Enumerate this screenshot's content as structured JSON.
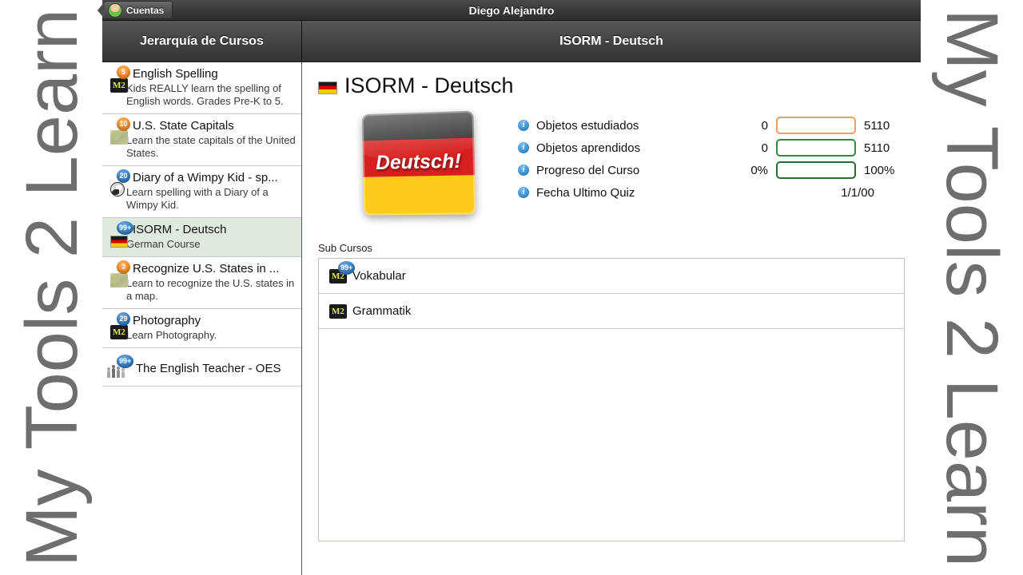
{
  "watermark": {
    "text": "My Tools 2 Learn"
  },
  "topbar": {
    "account_button_label": "Cuentas",
    "account_icon": "avatar-icon",
    "user_name": "Diego Alejandro"
  },
  "headers": {
    "sidebar_title": "Jerarquía de Cursos",
    "content_title": "ISORM - Deutsch"
  },
  "sidebar": {
    "items": [
      {
        "title": "English Spelling",
        "description": "Kids REALLY learn the spelling of English words. Grades Pre-K to 5.",
        "badge": "5",
        "badge_color": "#f08a21",
        "icon": "m2-icon",
        "selected": false
      },
      {
        "title": "U.S. State Capitals",
        "description": "Learn the state capitals of the United States.",
        "badge": "10",
        "badge_color": "#f08a21",
        "icon": "map-icon",
        "selected": false
      },
      {
        "title": "Diary of a Wimpy Kid - sp...",
        "description": "Learn spelling with a Diary of a Wimpy Kid.",
        "badge": "20",
        "badge_color": "#2f77bd",
        "icon": "face-icon",
        "selected": false
      },
      {
        "title": "ISORM - Deutsch",
        "description": "German Course",
        "badge": "99+",
        "badge_color": "#2f77bd",
        "icon": "german-flag-icon",
        "selected": true
      },
      {
        "title": "Recognize U.S. States in ...",
        "description": "Learn to recognize the U.S. states in a map.",
        "badge": "3",
        "badge_color": "#f08a21",
        "icon": "map-icon",
        "selected": false
      },
      {
        "title": "Photography",
        "description": "Learn Photography.",
        "badge": "29",
        "badge_color": "#2f77bd",
        "icon": "m2-icon",
        "selected": false
      },
      {
        "title": "The English Teacher - OES",
        "description": "",
        "badge": "99+",
        "badge_color": "#2f77bd",
        "icon": "people-icon",
        "selected": false
      }
    ]
  },
  "main": {
    "course_title": "ISORM - Deutsch",
    "course_flag_icon": "german-flag-icon",
    "course_image_text": "Deutsch!",
    "stats": [
      {
        "label": "Objetos estudiados",
        "min": "0",
        "max": "5110",
        "bar": true,
        "bar_color": "#e8a05a"
      },
      {
        "label": "Objetos aprendidos",
        "min": "0",
        "max": "5110",
        "bar": true,
        "bar_color": "#2f8a3d"
      },
      {
        "label": "Progreso del Curso",
        "min": "0%",
        "max": "100%",
        "bar": true,
        "bar_color": "#2d6b35"
      },
      {
        "label": "Fecha Ultimo Quiz",
        "min": "",
        "max": "",
        "bar": false,
        "value": "1/1/00"
      }
    ],
    "sub_courses_label": "Sub Cursos",
    "sub_courses": [
      {
        "title": "Vokabular",
        "badge": "99+",
        "badge_color": "#2f77bd",
        "icon": "m2-icon"
      },
      {
        "title": "Grammatik",
        "badge": "",
        "badge_color": "",
        "icon": "m2-icon"
      }
    ]
  },
  "colors": {
    "selected_row": "#dfeade",
    "header_dark": "#464646",
    "badge_orange": "#f08a21",
    "badge_blue": "#2f77bd"
  }
}
